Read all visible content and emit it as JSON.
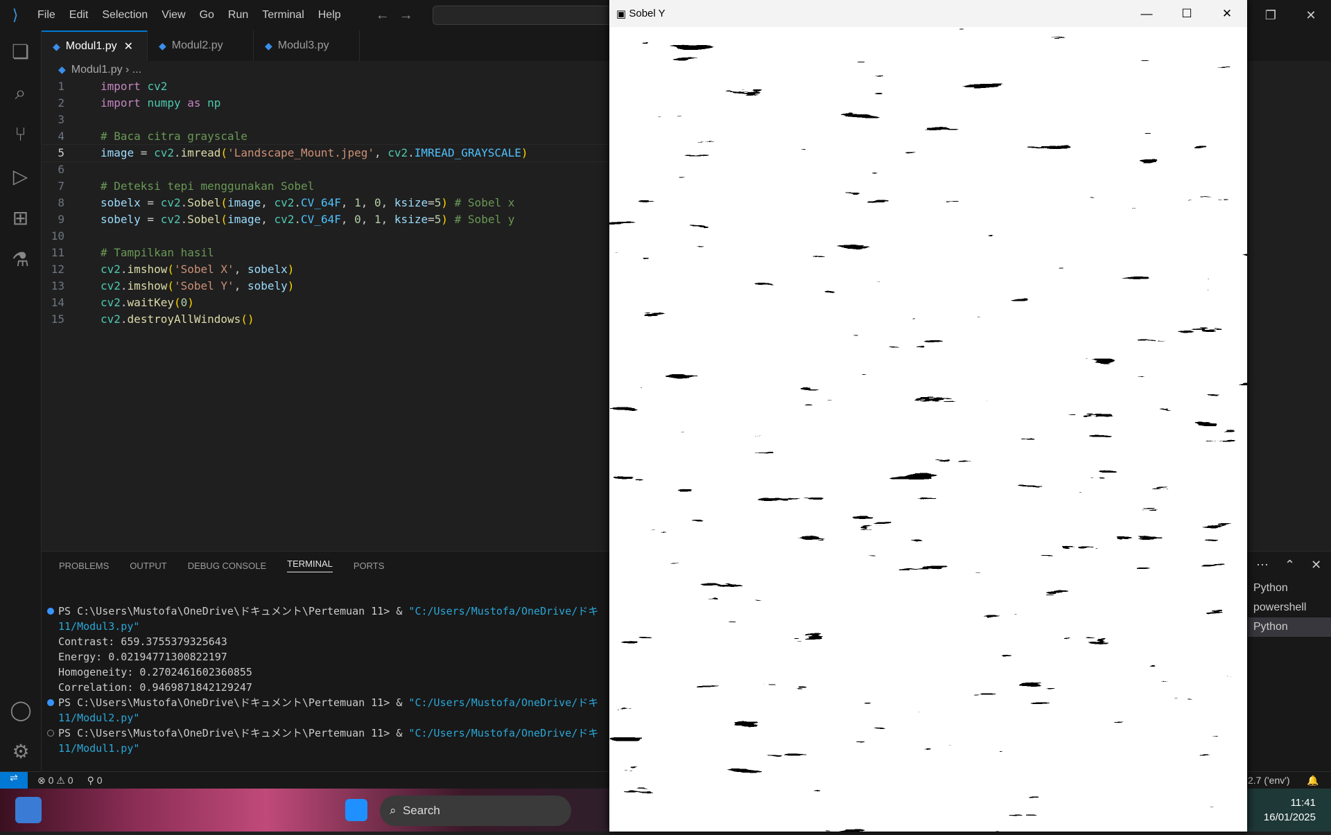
{
  "menu": [
    "File",
    "Edit",
    "Selection",
    "View",
    "Go",
    "Run",
    "Terminal",
    "Help"
  ],
  "tabs": [
    {
      "label": "Modul1.py",
      "active": true
    },
    {
      "label": "Modul2.py"
    },
    {
      "label": "Modul3.py"
    }
  ],
  "breadcrumb": {
    "file": "Modul1.py",
    "rest": "..."
  },
  "code_lines": [
    "1",
    "2",
    "3",
    "4",
    "5",
    "6",
    "7",
    "8",
    "9",
    "10",
    "11",
    "12",
    "13",
    "14",
    "15"
  ],
  "panel": {
    "tabs": [
      "PROBLEMS",
      "OUTPUT",
      "DEBUG CONSOLE",
      "TERMINAL",
      "PORTS"
    ],
    "terminal": {
      "prompt": "PS C:\\Users\\Mustofa\\OneDrive\\ドキュメント\\Pertemuan 11> & ",
      "cmd_prefix": "\"C:/Users/Mustofa/OneDrive/ドキ",
      "cmd3": "11/Modul3.py\"",
      "cmd2": "11/Modul2.py\"",
      "cmd1": "11/Modul1.py\"",
      "out": [
        "Contrast: 659.3755379325643",
        "Energy: 0.02194771300822197",
        "Homogeneity: 0.2702461602360855",
        "Correlation: 0.9469871842129247"
      ]
    },
    "terminals": [
      "Python",
      "powershell",
      "Python"
    ]
  },
  "status": {
    "errors": "0",
    "warnings": "0",
    "ports": "0",
    "python_env": "2.7 ('env')"
  },
  "sobel_window": {
    "title": "Sobel Y"
  },
  "taskbar": {
    "search": "Search",
    "time": "11:41",
    "date": "16/01/2025"
  }
}
